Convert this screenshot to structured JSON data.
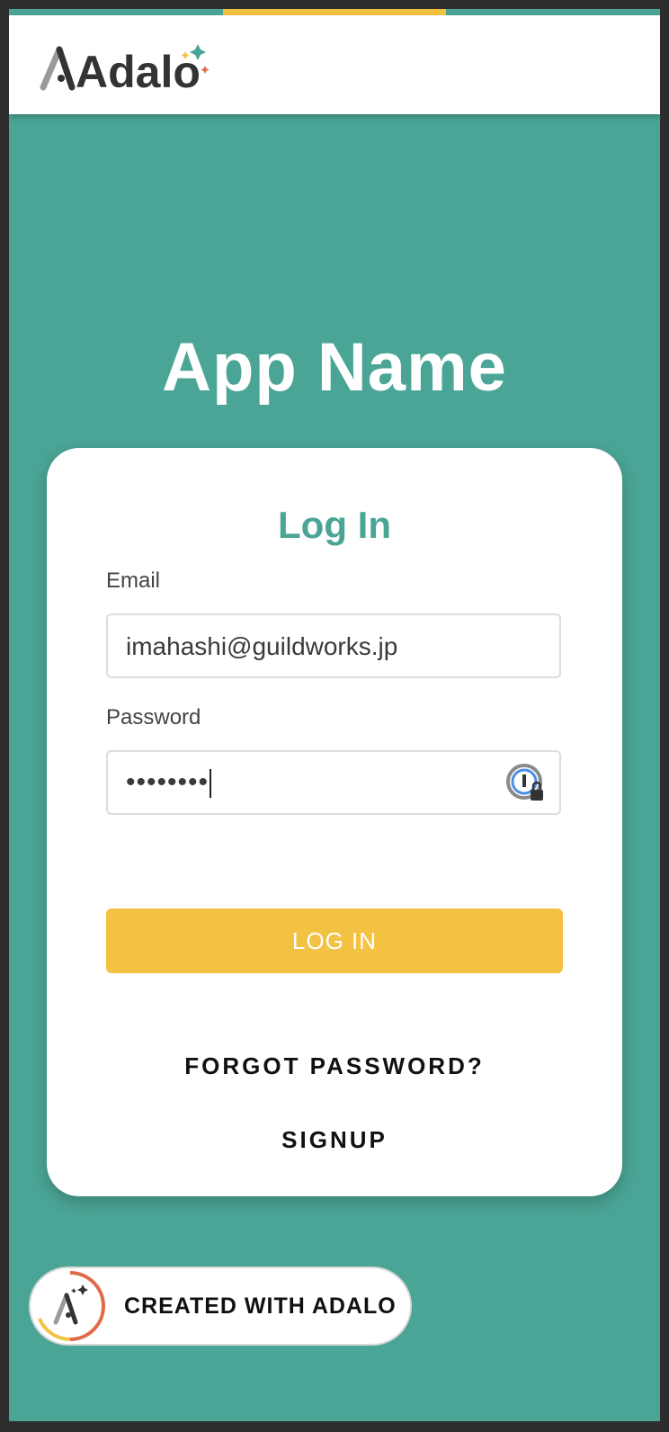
{
  "header": {
    "logo_text": "Adalo"
  },
  "app": {
    "title": "App Name"
  },
  "login": {
    "title": "Log In",
    "email_label": "Email",
    "email_value": "imahashi@guildworks.jp",
    "password_label": "Password",
    "password_masked": "••••••••",
    "submit_label": "LOG IN",
    "forgot_label": "FORGOT PASSWORD?",
    "signup_label": "SIGNUP"
  },
  "footer": {
    "badge_label": "CREATED WITH ADALO"
  },
  "colors": {
    "background_teal": "#4aa596",
    "accent_yellow": "#f4c243",
    "card": "#ffffff",
    "outer_frame": "#2d2d2d"
  },
  "icons": {
    "logo": "adalo-logo",
    "password_manager": "password-manager-lock-icon",
    "badge": "adalo-badge-icon"
  }
}
